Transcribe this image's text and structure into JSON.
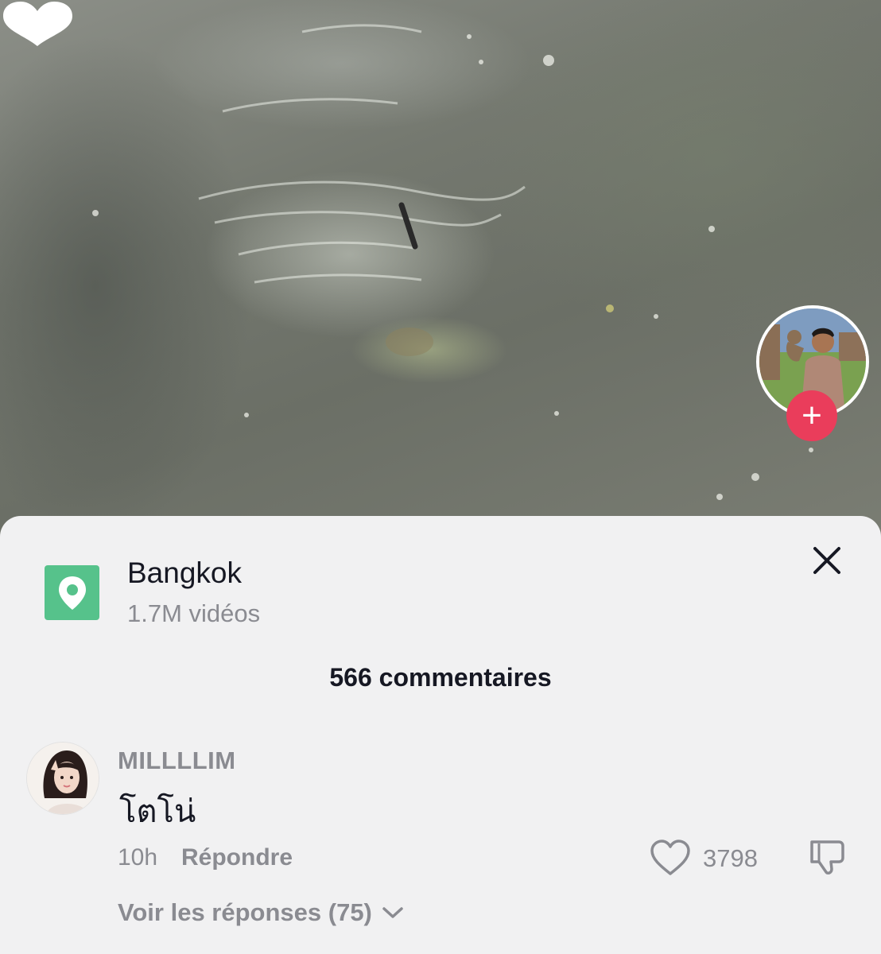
{
  "video": {
    "creator_avatar_icon": "creator-avatar",
    "follow_label": "+",
    "follow_color": "#ea3d5b"
  },
  "location": {
    "icon": "location-pin-icon",
    "icon_color": "#56c28b",
    "name": "Bangkok",
    "video_count": "1.7M vidéos"
  },
  "comments": {
    "count_label": "566 commentaires",
    "items": [
      {
        "username": "MILLLLIM",
        "text": "โตโน่",
        "time": "10h",
        "reply_label": "Répondre",
        "likes": "3798",
        "view_replies_label": "Voir les réponses (75)"
      }
    ]
  }
}
